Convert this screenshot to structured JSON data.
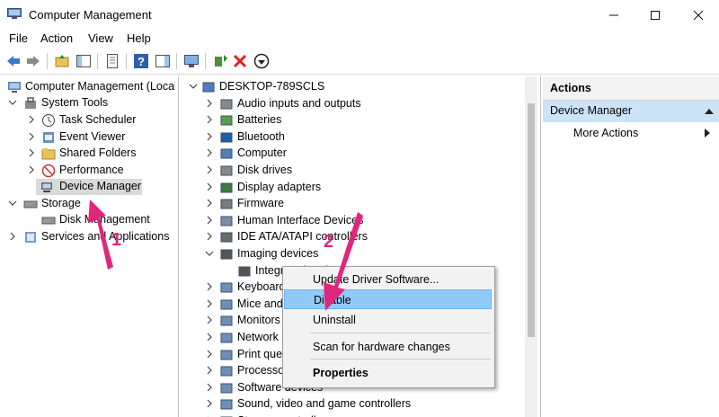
{
  "window": {
    "title": "Computer Management"
  },
  "menu": [
    "File",
    "Action",
    "View",
    "Help"
  ],
  "left_tree": {
    "root": "Computer Management (Local",
    "system_tools": "System Tools",
    "task_scheduler": "Task Scheduler",
    "event_viewer": "Event Viewer",
    "shared_folders": "Shared Folders",
    "performance": "Performance",
    "device_manager": "Device Manager",
    "storage": "Storage",
    "disk_management": "Disk Management",
    "services": "Services and Applications"
  },
  "device_tree": {
    "computer": "DESKTOP-789SCLS",
    "categories": [
      "Audio inputs and outputs",
      "Batteries",
      "Bluetooth",
      "Computer",
      "Disk drives",
      "Display adapters",
      "Firmware",
      "Human Interface Devices",
      "IDE ATA/ATAPI controllers",
      "Imaging devices"
    ],
    "imaging_child": "Integrated Webcam",
    "after": [
      "Keyboards",
      "Mice and other pointing devices",
      "Monitors",
      "Network adapters",
      "Print queues",
      "Processors",
      "Software devices",
      "Sound, video and game controllers",
      "Storage controllers"
    ]
  },
  "actions": {
    "header": "Actions",
    "group": "Device Manager",
    "more": "More Actions"
  },
  "context_menu": {
    "update": "Update Driver Software...",
    "disable": "Disable",
    "uninstall": "Uninstall",
    "scan": "Scan for hardware changes",
    "properties": "Properties"
  },
  "annotations": {
    "one": "1",
    "two": "2"
  },
  "colors": {
    "selection": "#91c9f7",
    "arrow": "#e0267c",
    "actions_selected": "#cce4f7"
  }
}
